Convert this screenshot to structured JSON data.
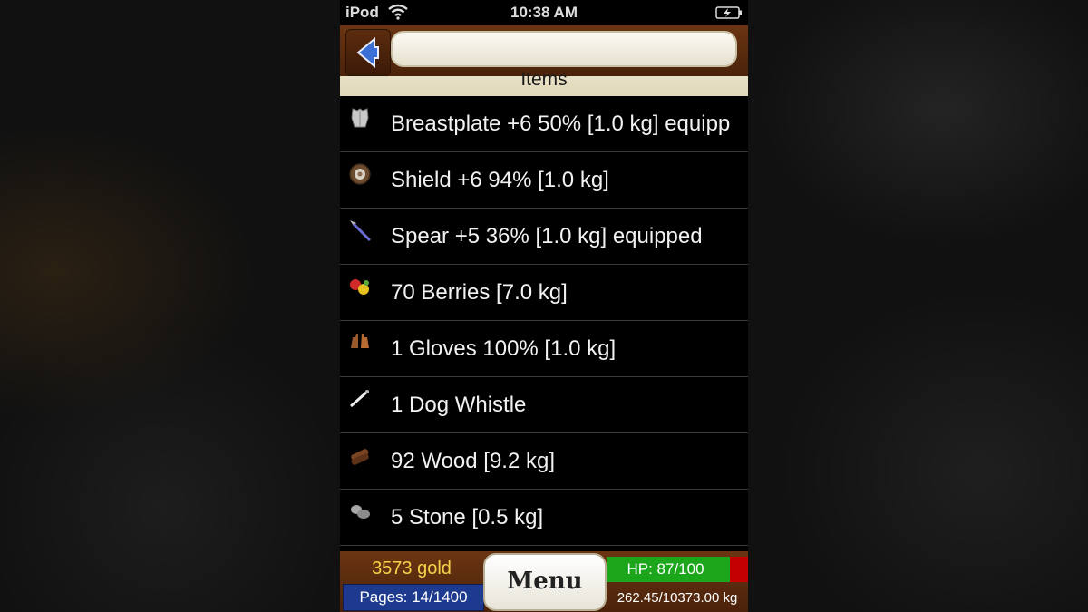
{
  "status_bar": {
    "carrier": "iPod",
    "time": "10:38 AM"
  },
  "header": {
    "title": "Items",
    "title_field_value": ""
  },
  "items": [
    {
      "label": "Breastplate +6 50% [1.0 kg] equipp",
      "icon": "armor-icon"
    },
    {
      "label": "Shield +6 94% [1.0 kg]",
      "icon": "shield-icon"
    },
    {
      "label": "Spear +5 36% [1.0 kg] equipped",
      "icon": "spear-icon"
    },
    {
      "label": "70 Berries [7.0 kg]",
      "icon": "berries-icon"
    },
    {
      "label": "1 Gloves 100%  [1.0 kg]",
      "icon": "gloves-icon"
    },
    {
      "label": "1 Dog Whistle",
      "icon": "whistle-icon"
    },
    {
      "label": "92 Wood [9.2 kg]",
      "icon": "wood-icon"
    },
    {
      "label": "5 Stone [0.5 kg]",
      "icon": "stone-icon"
    }
  ],
  "bottom_bar": {
    "gold": "3573 gold",
    "pages": "Pages: 14/1400",
    "menu_label": "Menu",
    "hp": "HP: 87/100",
    "hp_fraction": 0.87,
    "weight": "262.45/10373.00 kg"
  },
  "colors": {
    "frame": "#5a2a0c",
    "gold_text": "#f4d34a",
    "hp_green": "#1ca61c",
    "hp_red": "#c40000",
    "pages_blue": "#1d3a8f"
  }
}
